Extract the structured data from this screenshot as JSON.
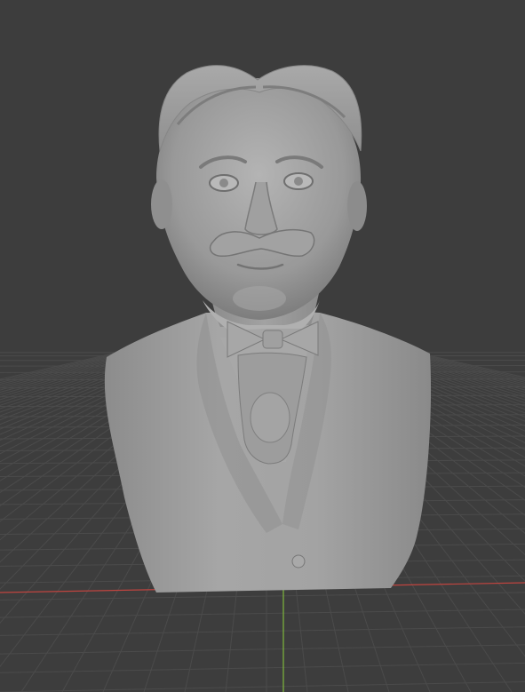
{
  "viewport": {
    "background": "#3d3d3d",
    "grid_color": "#4b4b4b",
    "grid_minor_color": "#454545",
    "x_axis_color": "#c0443f",
    "y_axis_color": "#7fb83c"
  },
  "model": {
    "name": "bust-sculpture",
    "material_color": "#9a9a9a",
    "shadow_color": "#6f6f6f",
    "highlight_color": "#b8b8b8"
  }
}
